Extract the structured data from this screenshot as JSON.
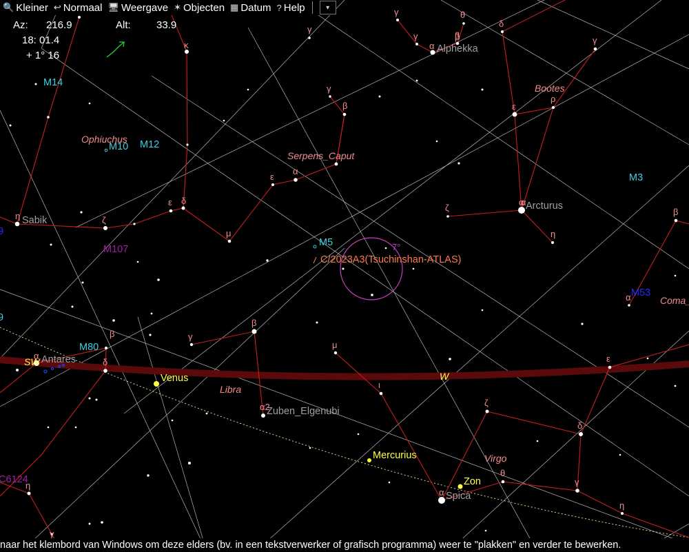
{
  "menu": {
    "items": [
      {
        "label": "Kleiner",
        "icon": "magnifier-icon",
        "glyph": "🔍"
      },
      {
        "label": "Normaal",
        "icon": "undo-arrow-icon",
        "glyph": "↩"
      },
      {
        "label": "Weergave",
        "icon": "monitor-icon",
        "glyph": "🖥"
      },
      {
        "label": "Objecten",
        "icon": "stars-icon",
        "glyph": "✶"
      },
      {
        "label": "Datum",
        "icon": "calendar-icon",
        "glyph": "▦"
      },
      {
        "label": "Help",
        "icon": "question-icon",
        "glyph": "?"
      }
    ],
    "dropdown_glyph": "▾"
  },
  "readout": {
    "az_label": "Az:",
    "az_value": "216.9",
    "alt_label": "Alt:",
    "alt_value": "33.9",
    "time": "18: 01.4",
    "offset": "+ 1° 16"
  },
  "status_text": "naar het klembord van Windows om deze elders (bv. in een tekstverwerker of grafisch programma) weer te \"plakken\" en verder te bewerken.",
  "colors": {
    "constellation_line": "#c81e1e",
    "constellation_name": "#f28c8c",
    "grid": "#d8d8d8",
    "ecliptic": "#dcdc90",
    "horizon": "#5a0a0a",
    "cluster": "#3fd0e0",
    "galaxy": "#2020ff",
    "nebula": "#a020a0",
    "comet": "#ff7a4a",
    "fov_circle": "#c040c0",
    "planet": "#ffff40",
    "star_name": "#a0a0a0"
  },
  "comet": {
    "name": "C/2023A3(Tsuchinshan-ATLAS)",
    "fov": "7°"
  },
  "planets": [
    "Venus",
    "Mercurius",
    "Zon"
  ],
  "compass": {
    "sw": "SW",
    "w": "W"
  },
  "constellation_names": [
    "Ophiuchus",
    "Serpens_Caput",
    "Bootes",
    "Libra",
    "Virgo",
    "Coma_"
  ],
  "star_names": [
    "Sabik",
    "Antares",
    "Arcturus",
    "Alphekka",
    "Zuben_Elgenubi",
    "Spica"
  ],
  "deep_sky": {
    "clusters": [
      "M14",
      "M10",
      "M12",
      "M5",
      "M3",
      "M80"
    ],
    "galaxies": [
      "M53"
    ],
    "nebulae": [
      "M107",
      "C6124"
    ],
    "edge_partials": [
      "9",
      "9"
    ]
  },
  "greek_labels": [
    "κ",
    "γ",
    "ζ",
    "ε",
    "δ",
    "η",
    "μ",
    "ε",
    "α",
    "β",
    "γ",
    "ζ",
    "α",
    "η",
    "β",
    "γ",
    "β",
    "α",
    "ι",
    "μ",
    "α2",
    "ε",
    "ζ",
    "δ",
    "γ",
    "θ",
    "α",
    "η",
    "β",
    "δ",
    "γ",
    "β",
    "α",
    "ε",
    "ρ",
    "δ",
    "γ",
    "θ",
    "α",
    "β",
    "γ",
    "α",
    "η",
    "γ"
  ]
}
